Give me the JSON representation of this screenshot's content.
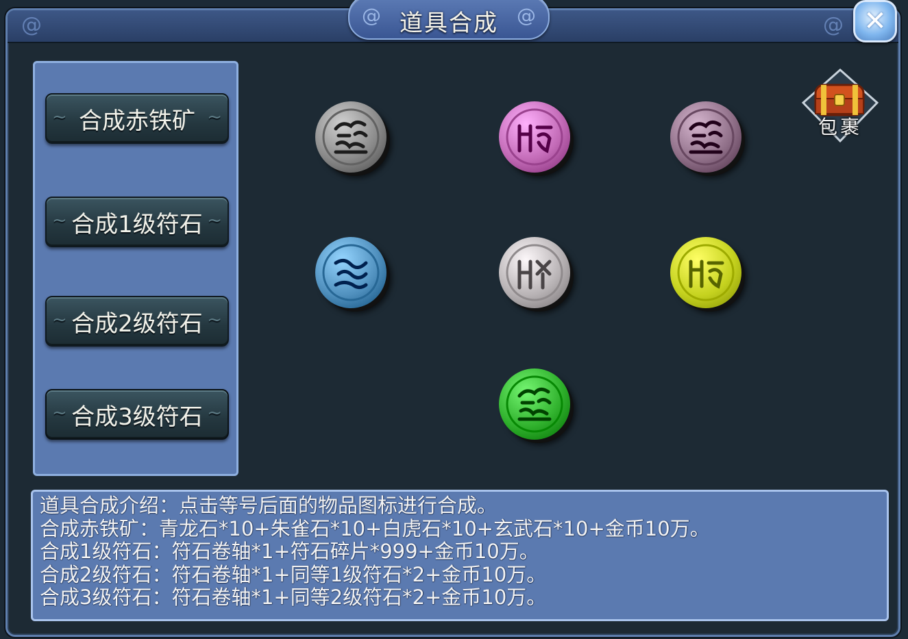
{
  "window": {
    "title": "道具合成",
    "close_glyph": "✕"
  },
  "menu": {
    "items": [
      {
        "label": "合成赤铁矿"
      },
      {
        "label": "合成1级符石"
      },
      {
        "label": "合成2级符石"
      },
      {
        "label": "合成3级符石"
      }
    ]
  },
  "bag": {
    "label": "包裹",
    "icon": "treasure-chest-icon"
  },
  "stones": [
    {
      "name": "stone-gray-rune",
      "color": "#8a8a8a",
      "glyph": "dragon-rune-icon"
    },
    {
      "name": "stone-pink-rune",
      "color": "#c26ab6",
      "glyph": "bird-rune-icon"
    },
    {
      "name": "stone-purple-gray-rune",
      "color": "#8f6f88",
      "glyph": "dragon-rune-icon"
    },
    {
      "name": "stone-blue-rune",
      "color": "#4f8fbd",
      "glyph": "wave-rune-icon"
    },
    {
      "name": "stone-silver-rune",
      "color": "#b7b2b4",
      "glyph": "tiger-rune-icon"
    },
    {
      "name": "stone-yellow-rune",
      "color": "#c5d21f",
      "glyph": "bird-rune-icon"
    },
    {
      "name": "stone-green-rune",
      "color": "#2fb02c",
      "glyph": "dragon-rune-icon"
    }
  ],
  "description": {
    "lines": [
      "道具合成介绍：点击等号后面的物品图标进行合成。",
      "合成赤铁矿：青龙石*10+朱雀石*10+白虎石*10+玄武石*10+金币10万。",
      "合成1级符石：符石卷轴*1+符石碎片*999+金币10万。",
      "合成2级符石：符石卷轴*1+同等1级符石*2+金币10万。",
      "合成3级符石：符石卷轴*1+同等2级符石*2+金币10万。"
    ]
  }
}
